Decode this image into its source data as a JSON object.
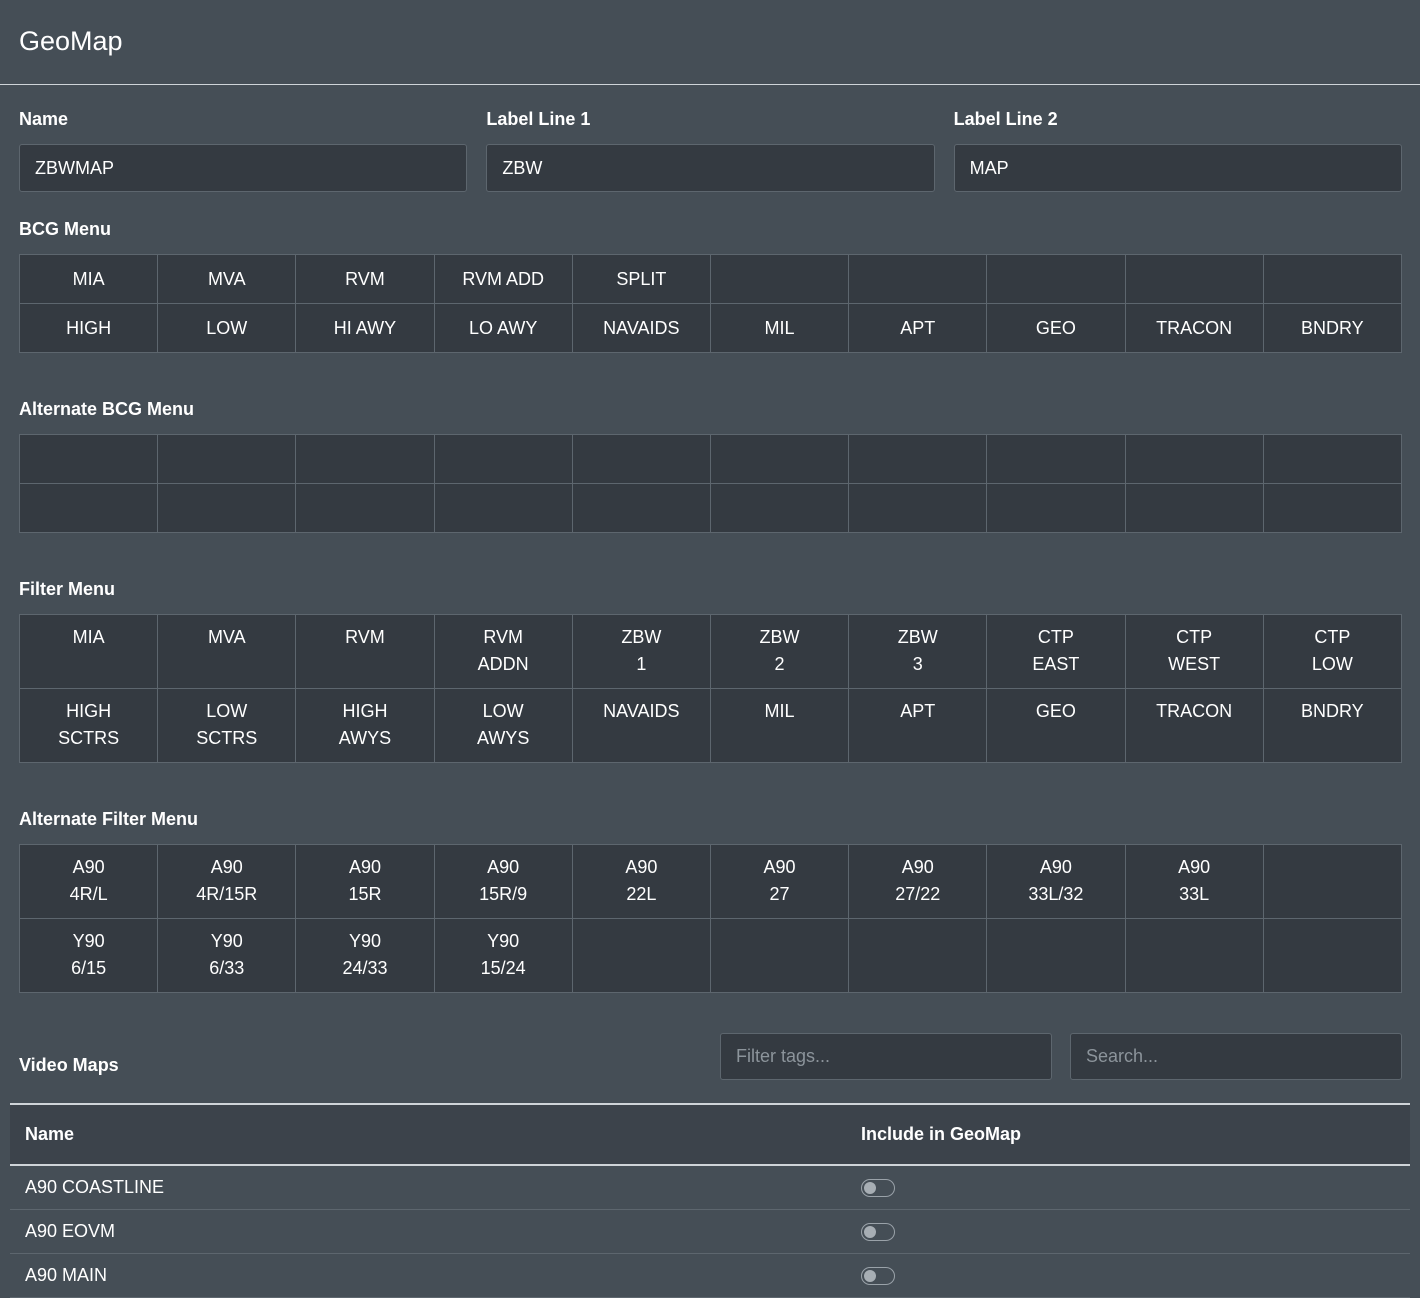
{
  "header": {
    "title": "GeoMap"
  },
  "fields": {
    "name": {
      "label": "Name",
      "value": "ZBWMAP"
    },
    "label1": {
      "label": "Label Line 1",
      "value": "ZBW"
    },
    "label2": {
      "label": "Label Line 2",
      "value": "MAP"
    }
  },
  "bcg_menu": {
    "label": "BCG Menu",
    "rows": [
      [
        "MIA",
        "MVA",
        "RVM",
        "RVM ADD",
        "SPLIT",
        "",
        "",
        "",
        "",
        ""
      ],
      [
        "HIGH",
        "LOW",
        "HI AWY",
        "LO AWY",
        "NAVAIDS",
        "MIL",
        "APT",
        "GEO",
        "TRACON",
        "BNDRY"
      ]
    ]
  },
  "alt_bcg_menu": {
    "label": "Alternate BCG Menu",
    "rows": [
      [
        "",
        "",
        "",
        "",
        "",
        "",
        "",
        "",
        "",
        ""
      ],
      [
        "",
        "",
        "",
        "",
        "",
        "",
        "",
        "",
        "",
        ""
      ]
    ]
  },
  "filter_menu": {
    "label": "Filter Menu",
    "rows": [
      [
        [
          "MIA",
          ""
        ],
        [
          "MVA",
          ""
        ],
        [
          "RVM",
          ""
        ],
        [
          "RVM",
          "ADDN"
        ],
        [
          "ZBW",
          "1"
        ],
        [
          "ZBW",
          "2"
        ],
        [
          "ZBW",
          "3"
        ],
        [
          "CTP",
          "EAST"
        ],
        [
          "CTP",
          "WEST"
        ],
        [
          "CTP",
          "LOW"
        ]
      ],
      [
        [
          "HIGH",
          "SCTRS"
        ],
        [
          "LOW",
          "SCTRS"
        ],
        [
          "HIGH",
          "AWYS"
        ],
        [
          "LOW",
          "AWYS"
        ],
        [
          "NAVAIDS",
          ""
        ],
        [
          "MIL",
          ""
        ],
        [
          "APT",
          ""
        ],
        [
          "GEO",
          ""
        ],
        [
          "TRACON",
          ""
        ],
        [
          "BNDRY",
          ""
        ]
      ]
    ]
  },
  "alt_filter_menu": {
    "label": "Alternate Filter Menu",
    "rows": [
      [
        [
          "A90",
          "4R/L"
        ],
        [
          "A90",
          "4R/15R"
        ],
        [
          "A90",
          "15R"
        ],
        [
          "A90",
          "15R/9"
        ],
        [
          "A90",
          "22L"
        ],
        [
          "A90",
          "27"
        ],
        [
          "A90",
          "27/22"
        ],
        [
          "A90",
          "33L/32"
        ],
        [
          "A90",
          "33L"
        ],
        [
          "",
          ""
        ]
      ],
      [
        [
          "Y90",
          "6/15"
        ],
        [
          "Y90",
          "6/33"
        ],
        [
          "Y90",
          "24/33"
        ],
        [
          "Y90",
          "15/24"
        ],
        [
          "",
          ""
        ],
        [
          "",
          ""
        ],
        [
          "",
          ""
        ],
        [
          "",
          ""
        ],
        [
          "",
          ""
        ],
        [
          "",
          ""
        ]
      ]
    ]
  },
  "video_maps": {
    "label": "Video Maps",
    "filter_placeholder": "Filter tags...",
    "search_placeholder": "Search...",
    "columns": {
      "name": "Name",
      "include": "Include in GeoMap"
    },
    "rows": [
      {
        "name": "A90 COASTLINE",
        "included": false
      },
      {
        "name": "A90 EOVM",
        "included": false
      },
      {
        "name": "A90 MAIN",
        "included": false
      }
    ]
  }
}
